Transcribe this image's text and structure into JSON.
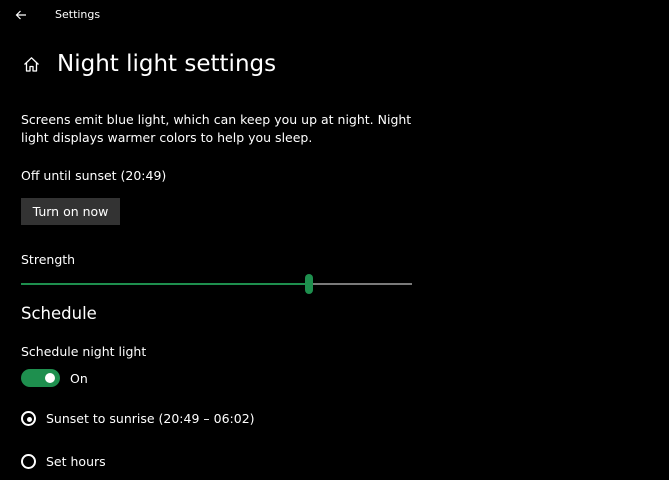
{
  "window": {
    "app_title": "Settings",
    "back_icon": "arrow-left-icon"
  },
  "header": {
    "home_icon": "home-icon",
    "title": "Night light settings"
  },
  "description": "Screens emit blue light, which can keep you up at night. Night light displays warmer colors to help you sleep.",
  "status": "Off until sunset (20:49)",
  "turn_on_button": {
    "label": "Turn on now"
  },
  "strength": {
    "label": "Strength",
    "value_fraction": 0.737
  },
  "schedule": {
    "heading": "Schedule",
    "toggle_label": "Schedule night light",
    "toggle_state": "On",
    "toggle_on": true,
    "options": [
      {
        "label": "Sunset to sunrise (20:49 – 06:02)",
        "selected": true
      },
      {
        "label": "Set hours",
        "selected": false
      }
    ]
  },
  "colors": {
    "accent": "#1e8f4e",
    "background": "#000000",
    "button": "#333333",
    "track_empty": "#7a7a7a",
    "text": "#ffffff"
  }
}
